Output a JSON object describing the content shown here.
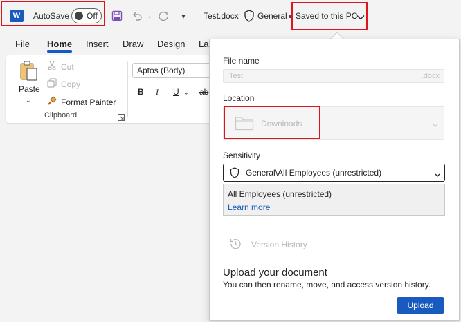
{
  "titlebar": {
    "app_logo_letter": "W",
    "autosave_label": "AutoSave",
    "autosave_state": "Off",
    "document_name": "Test.docx",
    "sensitivity_label": "General",
    "save_status": "Saved to this PC"
  },
  "ribbon": {
    "tabs": [
      {
        "label": "File"
      },
      {
        "label": "Home"
      },
      {
        "label": "Insert"
      },
      {
        "label": "Draw"
      },
      {
        "label": "Design"
      },
      {
        "label": "La"
      }
    ],
    "active_tab": "Home",
    "clipboard": {
      "paste_label": "Paste",
      "cut_label": "Cut",
      "copy_label": "Copy",
      "format_painter_label": "Format Painter",
      "group_label": "Clipboard"
    },
    "font": {
      "font_name": "Aptos (Body)",
      "bold": "B",
      "italic": "I",
      "underline": "U",
      "strike": "ab"
    }
  },
  "save_panel": {
    "file_name_label": "File name",
    "file_name_value": "Test",
    "file_extension": ".docx",
    "location_label": "Location",
    "location_value": "Downloads",
    "sensitivity_label": "Sensitivity",
    "sensitivity_value": "General\\All Employees (unrestricted)",
    "sensitivity_description": "All Employees (unrestricted)",
    "learn_more": "Learn more",
    "version_history": "Version History",
    "upload_title": "Upload your document",
    "upload_description": "You can then rename, move, and access version history.",
    "upload_button": "Upload"
  },
  "colors": {
    "accent": "#185abd",
    "highlight": "#e0141e"
  }
}
